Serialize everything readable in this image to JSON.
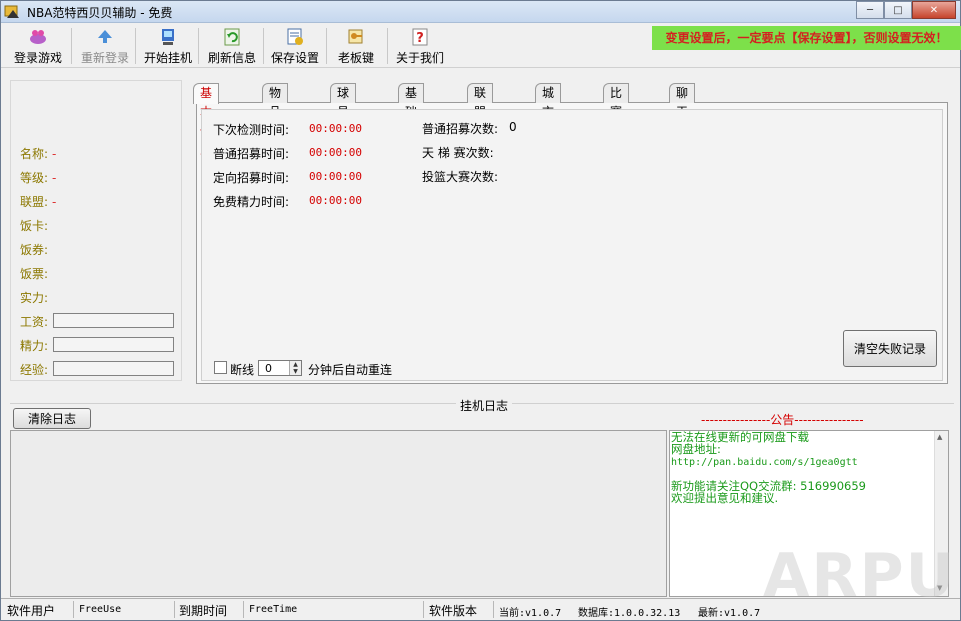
{
  "window": {
    "title": "NBA范特西贝贝辅助 - 免费"
  },
  "toolbar": {
    "login": "登录游戏",
    "relogin": "重新登录",
    "start": "开始挂机",
    "refresh": "刷新信息",
    "save": "保存设置",
    "bosskey": "老板键",
    "about": "关于我们"
  },
  "notice": "变更设置后，一定要点【保存设置】，否则设置无效！",
  "player": {
    "name_label": "名称:",
    "name_value": "-",
    "level_label": "等级:",
    "level_value": "-",
    "league_label": "联盟:",
    "league_value": "-",
    "rice_card": "饭卡:",
    "rice_coupon": "饭券:",
    "rice_ticket": "饭票:",
    "strength": "实力:",
    "salary": "工资:",
    "energy": "精力:",
    "exp": "经验:"
  },
  "tabs": [
    "基本信息",
    "物品信息",
    "球员信息",
    "基础设置",
    "联盟设置",
    "城市设置",
    "比赛设置",
    "聊天室"
  ],
  "basic": {
    "next_check_label": "下次检测时间:",
    "next_check_value": "00:00:00",
    "normal_recruit_label": "普通招募时间:",
    "normal_recruit_value": "00:00:00",
    "targeted_recruit_label": "定向招募时间:",
    "targeted_recruit_value": "00:00:00",
    "free_energy_label": "免费精力时间:",
    "free_energy_value": "00:00:00",
    "normal_recruit_count_label": "普通招募次数:",
    "normal_recruit_count_value": "0",
    "ladder_count_label": "天 梯 赛次数:",
    "dunk_count_label": "投篮大赛次数:",
    "disconnect_label": "断线",
    "reconnect_minutes": "0",
    "reconnect_suffix": "分钟后自动重连",
    "clear_fail_button": "清空失败记录"
  },
  "log": {
    "title": "挂机日志",
    "clear_button": "清除日志"
  },
  "announcement": {
    "title": "----------------公告----------------",
    "line1": "无法在线更新的可网盘下载",
    "line2": "网盘地址:",
    "line3": "http://pan.baidu.com/s/1gea0gtt",
    "line4": "新功能请关注QQ交流群: 516990659",
    "line5": "欢迎提出意见和建议."
  },
  "status": {
    "user_label": "软件用户",
    "user_value": "FreeUse",
    "expire_label": "到期时间",
    "expire_value": "FreeTime",
    "version_label": "软件版本",
    "current": "当前:v1.0.7",
    "database": "数据库:1.0.0.32.13",
    "latest": "最新:v1.0.7"
  },
  "watermark": "ARPUN"
}
